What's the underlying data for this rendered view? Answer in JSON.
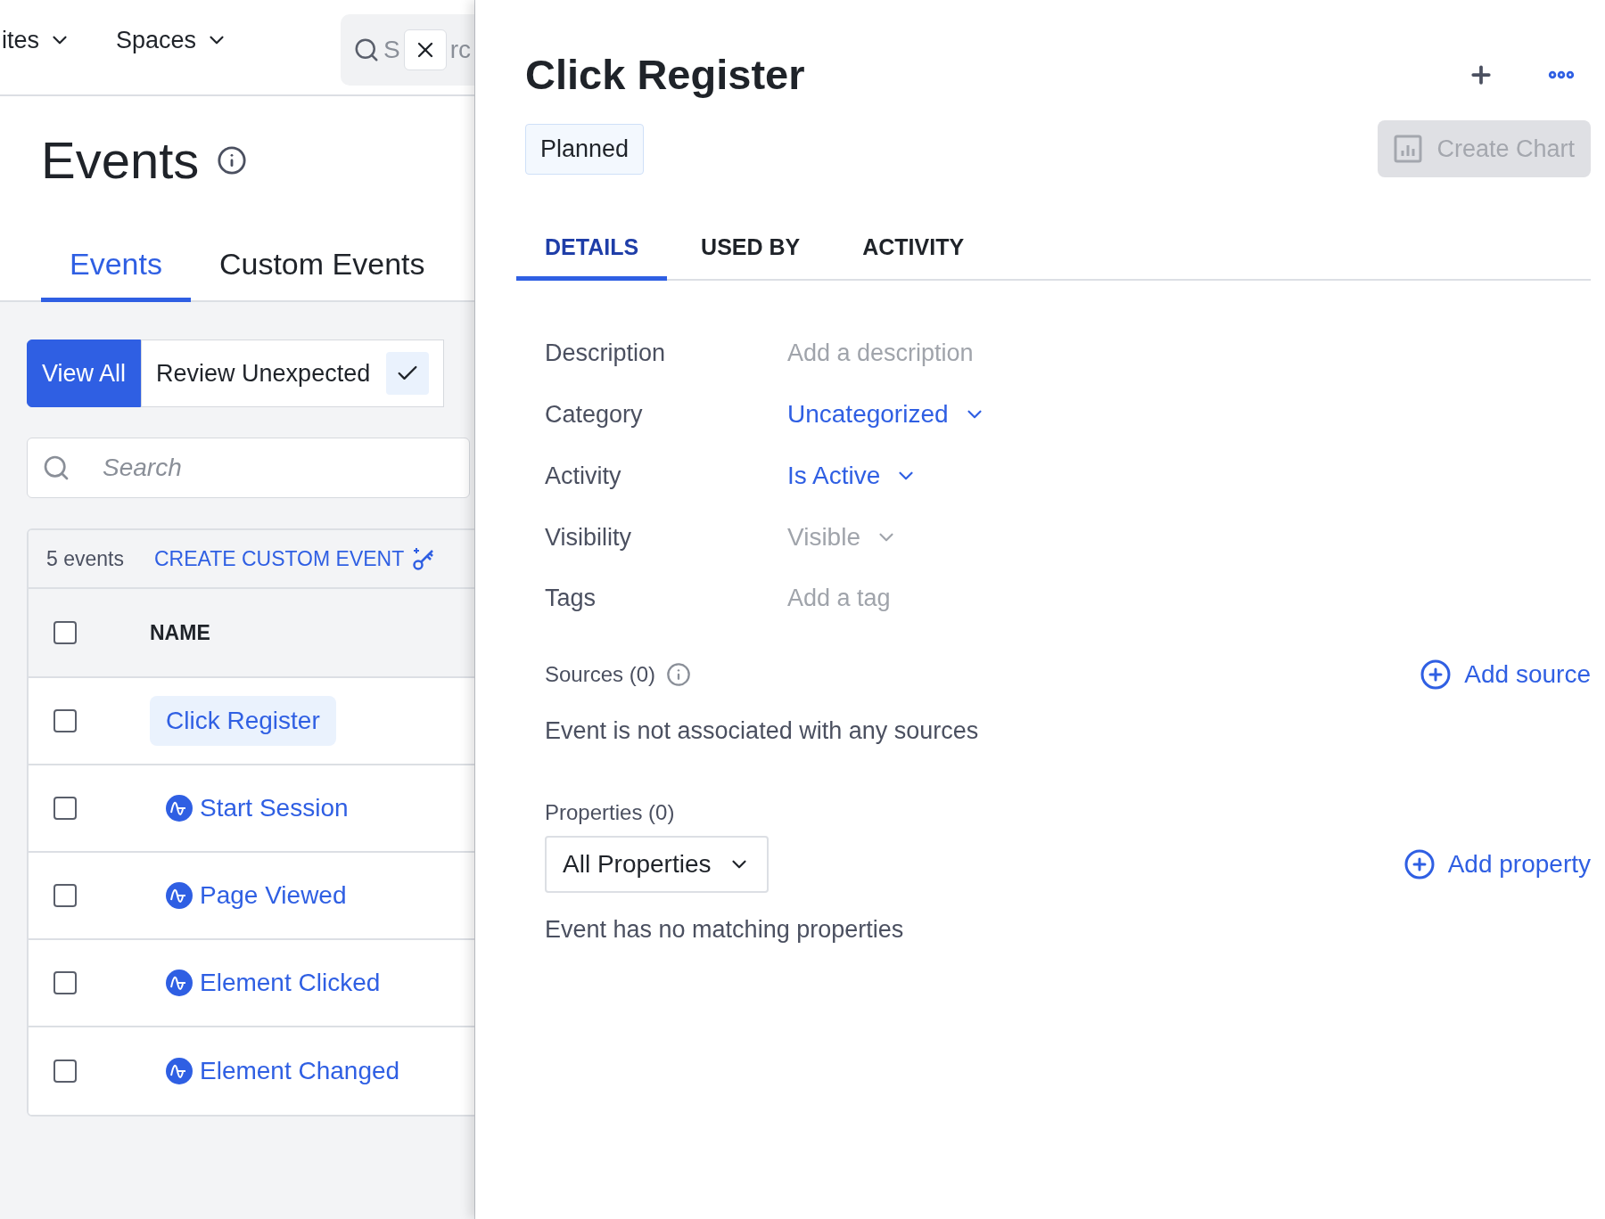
{
  "top_nav": {
    "items": [
      {
        "label": "ites"
      },
      {
        "label": "Spaces"
      }
    ],
    "search": {
      "text_before": "S",
      "text_after": "rc"
    }
  },
  "page": {
    "title": "Events",
    "tabs": [
      {
        "label": "Events",
        "selected": true
      },
      {
        "label": "Custom Events",
        "selected": false
      }
    ],
    "filters": [
      {
        "label": "View All",
        "selected": true,
        "kind": "plain"
      },
      {
        "label": "Review Unexpected",
        "selected": false,
        "kind": "check"
      }
    ],
    "search": {
      "placeholder": "Search"
    },
    "table": {
      "count": "5 events",
      "create_action": "CREATE CUSTOM EVENT",
      "columns": [
        "NAME"
      ],
      "header_checked": false,
      "rows": [
        {
          "name": "Click Register",
          "kind": "custom",
          "selected": true,
          "checked": false
        },
        {
          "name": "Start Session",
          "kind": "tracked",
          "selected": false,
          "checked": false
        },
        {
          "name": "Page Viewed",
          "kind": "tracked",
          "selected": false,
          "checked": false
        },
        {
          "name": "Element Clicked",
          "kind": "tracked",
          "selected": false,
          "checked": false
        },
        {
          "name": "Element Changed",
          "kind": "tracked",
          "selected": false,
          "checked": false
        }
      ]
    }
  },
  "drawer": {
    "title": "Click Register",
    "status": "Planned",
    "create_chart": {
      "label": "Create Chart",
      "disabled": true
    },
    "tabs": [
      {
        "label": "DETAILS",
        "selected": true
      },
      {
        "label": "USED BY",
        "selected": false
      },
      {
        "label": "ACTIVITY",
        "selected": false
      }
    ],
    "fields": [
      {
        "label": "Description",
        "kind": "placeholder",
        "placeholder": "Add a description"
      },
      {
        "label": "Category",
        "kind": "dropdown",
        "value": "Uncategorized",
        "disabled": false
      },
      {
        "label": "Activity",
        "kind": "dropdown",
        "value": "Is Active",
        "disabled": false
      },
      {
        "label": "Visibility",
        "kind": "dropdown",
        "value": "Visible",
        "disabled": true
      },
      {
        "label": "Tags",
        "kind": "placeholder",
        "placeholder": "Add a tag"
      }
    ],
    "sources": {
      "heading": "Sources (0)",
      "action": "Add source",
      "empty": "Event is not associated with any sources"
    },
    "properties": {
      "heading": "Properties (0)",
      "filter": "All Properties",
      "action": "Add property",
      "empty": "Event has no matching properties"
    }
  }
}
